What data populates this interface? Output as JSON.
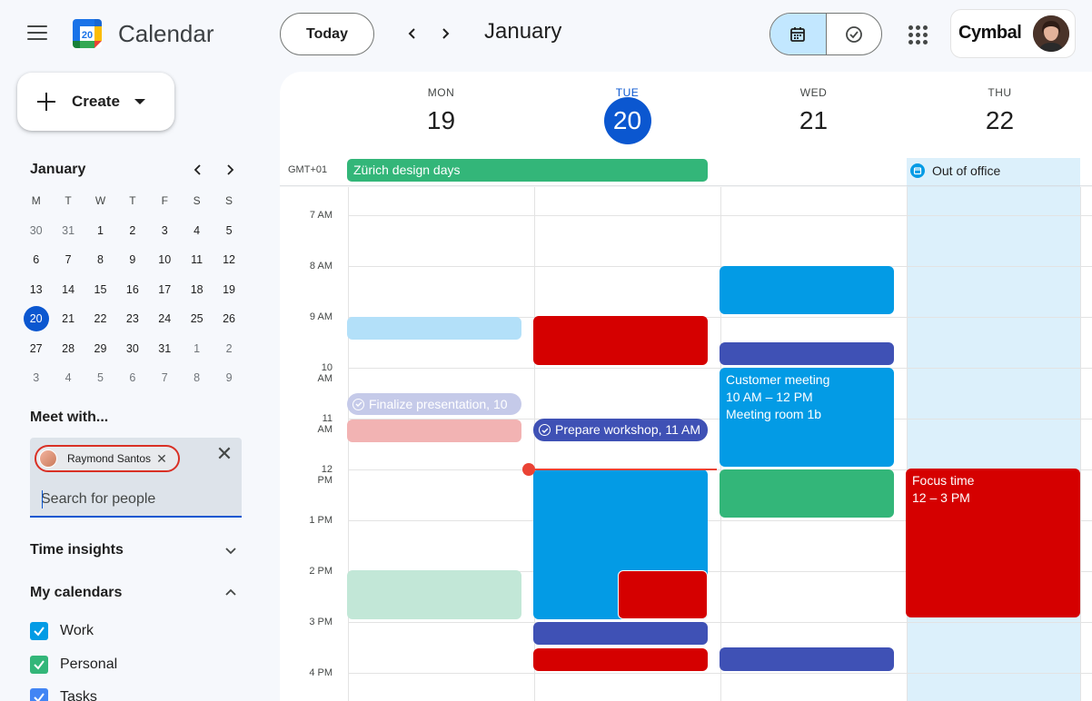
{
  "app": {
    "title": "Calendar",
    "logo_day": "20"
  },
  "toolbar": {
    "today_label": "Today",
    "month": "January"
  },
  "account": {
    "brand": "Cymbal"
  },
  "create": {
    "label": "Create"
  },
  "mini_calendar": {
    "title": "January",
    "weekdays": [
      "M",
      "T",
      "W",
      "T",
      "F",
      "S",
      "S"
    ],
    "weeks": [
      [
        "30",
        "31",
        "1",
        "2",
        "3",
        "4",
        "5"
      ],
      [
        "6",
        "7",
        "8",
        "9",
        "10",
        "11",
        "12"
      ],
      [
        "13",
        "14",
        "15",
        "16",
        "17",
        "18",
        "19"
      ],
      [
        "20",
        "21",
        "22",
        "23",
        "24",
        "25",
        "26"
      ],
      [
        "27",
        "28",
        "29",
        "30",
        "31",
        "1",
        "2"
      ],
      [
        "3",
        "4",
        "5",
        "6",
        "7",
        "8",
        "9"
      ]
    ],
    "today": "20"
  },
  "meet_with": {
    "title": "Meet with...",
    "chip_name": "Raymond Santos",
    "search_placeholder": "Search for people"
  },
  "sections": {
    "time_insights": "Time insights",
    "my_calendars": "My calendars"
  },
  "calendars": [
    {
      "name": "Work",
      "color": "#039be5"
    },
    {
      "name": "Personal",
      "color": "#33b679"
    },
    {
      "name": "Tasks",
      "color": "#4285f4"
    }
  ],
  "week": {
    "timezone": "GMT+01",
    "days": [
      {
        "dow": "MON",
        "num": "19"
      },
      {
        "dow": "TUE",
        "num": "20"
      },
      {
        "dow": "WED",
        "num": "21"
      },
      {
        "dow": "THU",
        "num": "22"
      }
    ],
    "hours": [
      "7 AM",
      "8 AM",
      "9 AM",
      "10 AM",
      "11 AM",
      "12 PM",
      "1 PM",
      "2 PM",
      "3 PM",
      "4 PM"
    ],
    "all_day": {
      "zurich": "Zürich design days",
      "out_of_office": "Out of office"
    }
  },
  "events": {
    "finalize": "Finalize presentation, 10",
    "prepare": "Prepare workshop, 11 AM",
    "customer_title": "Customer meeting",
    "customer_time": "10 AM – 12 PM",
    "customer_room": "Meeting room 1b",
    "focus_title": "Focus time",
    "focus_time": "12 – 3 PM"
  },
  "colors": {
    "primary": "#0b57d0",
    "peacock": "#039be5",
    "tomato": "#d50000",
    "blueberry": "#3f51b5",
    "basil_green": "#33b679",
    "now_line": "#ea4335"
  }
}
